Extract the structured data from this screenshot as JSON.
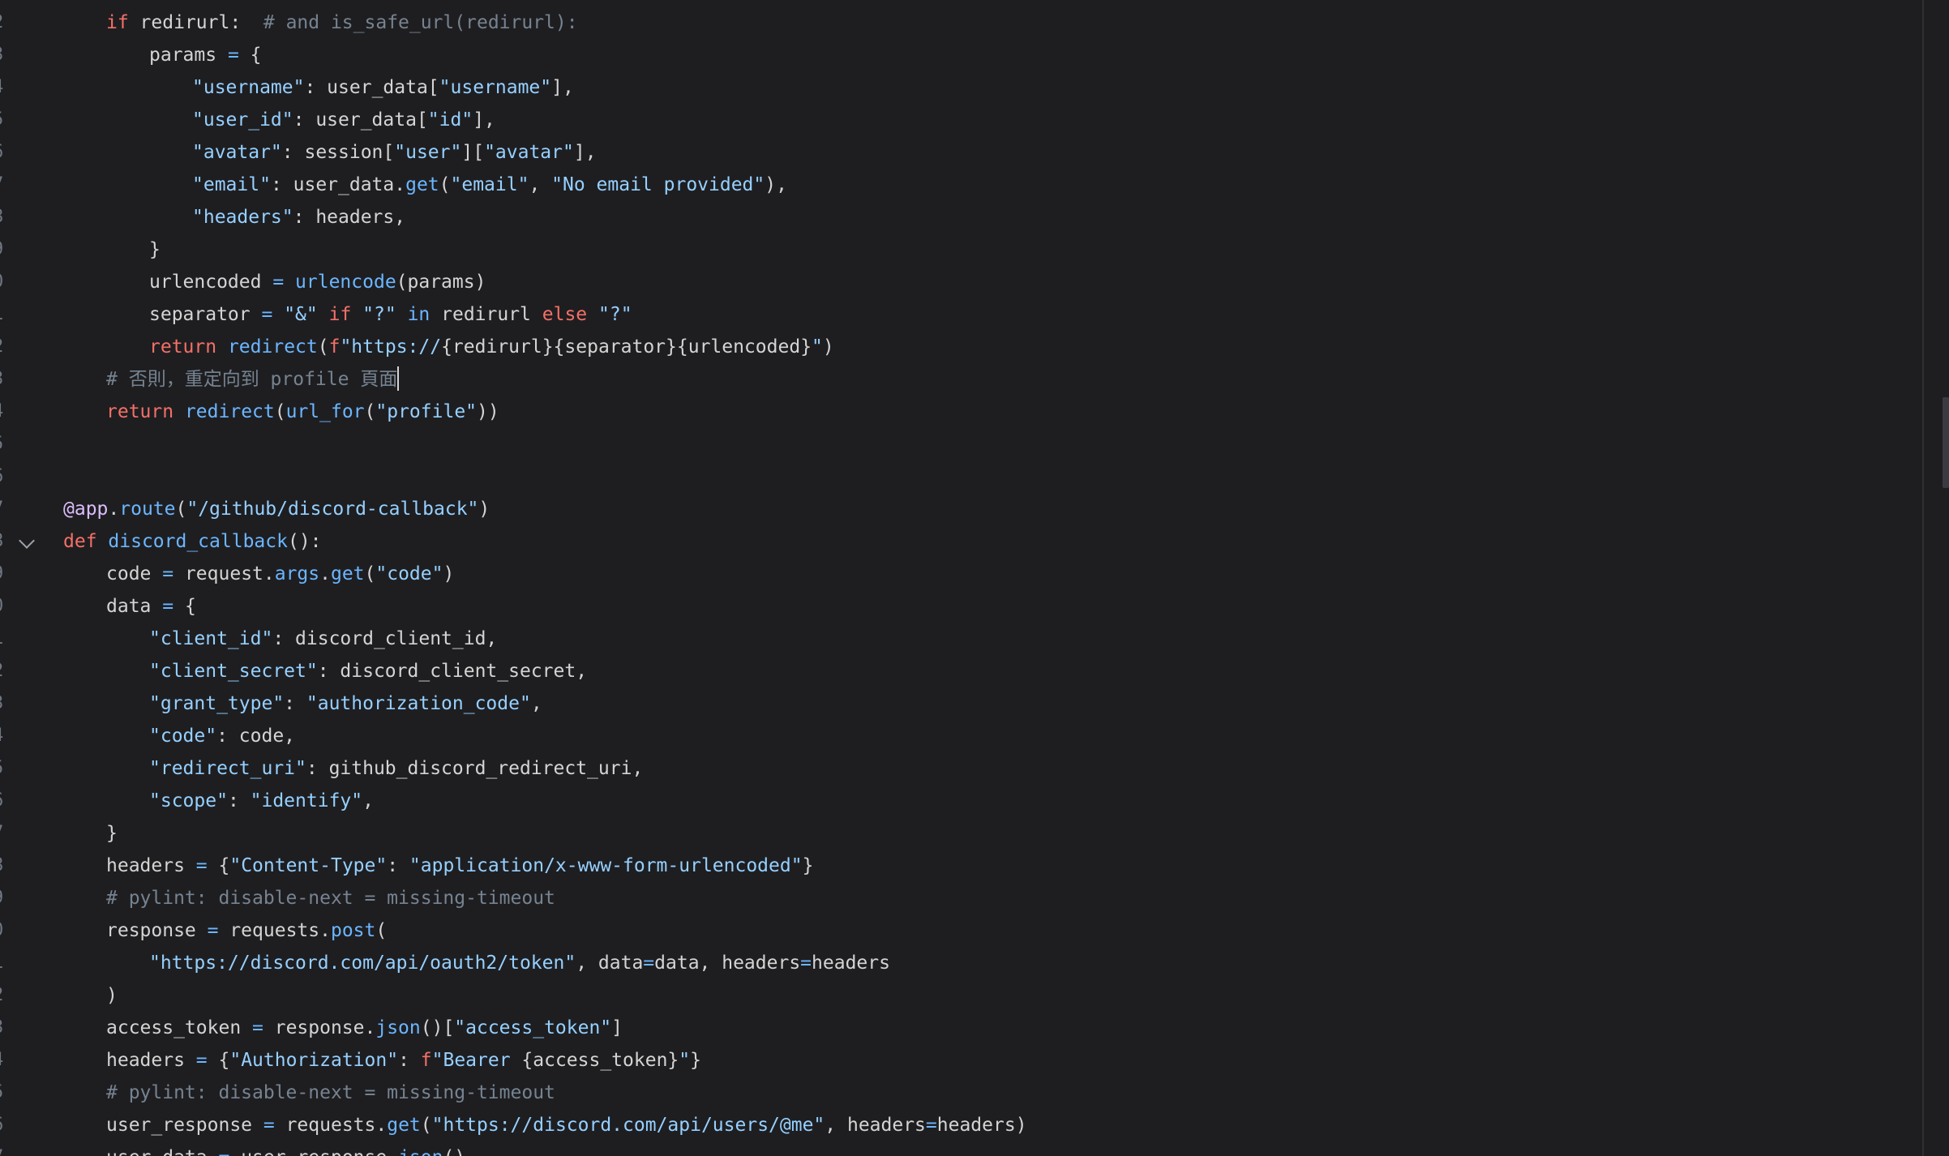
{
  "editor": {
    "colors": {
      "background": "#1e1e21",
      "text": "#d4d4d4",
      "keyword": "#f47067",
      "function": "#6cb6ff",
      "string": "#96d0ff",
      "comment": "#768390",
      "decorator": "#dcbdfb",
      "operator": "#6cb6ff"
    },
    "lines": [
      {
        "ln": "2",
        "indent": 1,
        "tokens": [
          [
            "kw",
            "if"
          ],
          [
            "d",
            " redirurl:  "
          ],
          [
            "c",
            "# and is_safe_url(redirurl):"
          ]
        ]
      },
      {
        "ln": "3",
        "indent": 2,
        "tokens": [
          [
            "d",
            "params "
          ],
          [
            "op",
            "="
          ],
          [
            "d",
            " {"
          ]
        ]
      },
      {
        "ln": "4",
        "indent": 3,
        "tokens": [
          [
            "s",
            "\"username\""
          ],
          [
            "d",
            ": user_data["
          ],
          [
            "s",
            "\"username\""
          ],
          [
            "d",
            "],"
          ]
        ]
      },
      {
        "ln": "5",
        "indent": 3,
        "tokens": [
          [
            "s",
            "\"user_id\""
          ],
          [
            "d",
            ": user_data["
          ],
          [
            "s",
            "\"id\""
          ],
          [
            "d",
            "],"
          ]
        ]
      },
      {
        "ln": "6",
        "indent": 3,
        "tokens": [
          [
            "s",
            "\"avatar\""
          ],
          [
            "d",
            ": session["
          ],
          [
            "s",
            "\"user\""
          ],
          [
            "d",
            "]["
          ],
          [
            "s",
            "\"avatar\""
          ],
          [
            "d",
            "],"
          ]
        ]
      },
      {
        "ln": "7",
        "indent": 3,
        "tokens": [
          [
            "s",
            "\"email\""
          ],
          [
            "d",
            ": user_data."
          ],
          [
            "fn",
            "get"
          ],
          [
            "d",
            "("
          ],
          [
            "s",
            "\"email\""
          ],
          [
            "d",
            ", "
          ],
          [
            "s",
            "\"No email provided\""
          ],
          [
            "d",
            "),"
          ]
        ]
      },
      {
        "ln": "8",
        "indent": 3,
        "tokens": [
          [
            "s",
            "\"headers\""
          ],
          [
            "d",
            ": headers,"
          ]
        ]
      },
      {
        "ln": "9",
        "indent": 2,
        "tokens": [
          [
            "d",
            "}"
          ]
        ]
      },
      {
        "ln": "0",
        "indent": 2,
        "tokens": [
          [
            "d",
            "urlencoded "
          ],
          [
            "op",
            "="
          ],
          [
            "d",
            " "
          ],
          [
            "fn",
            "urlencode"
          ],
          [
            "d",
            "(params)"
          ]
        ]
      },
      {
        "ln": "1",
        "indent": 2,
        "tokens": [
          [
            "d",
            "separator "
          ],
          [
            "op",
            "="
          ],
          [
            "d",
            " "
          ],
          [
            "s",
            "\"&\""
          ],
          [
            "d",
            " "
          ],
          [
            "kw",
            "if"
          ],
          [
            "d",
            " "
          ],
          [
            "s",
            "\"?\""
          ],
          [
            "d",
            " "
          ],
          [
            "fn",
            "in"
          ],
          [
            "d",
            " redirurl "
          ],
          [
            "kw",
            "else"
          ],
          [
            "d",
            " "
          ],
          [
            "s",
            "\"?\""
          ]
        ]
      },
      {
        "ln": "2",
        "indent": 2,
        "tokens": [
          [
            "kw",
            "return"
          ],
          [
            "d",
            " "
          ],
          [
            "fn",
            "redirect"
          ],
          [
            "d",
            "("
          ],
          [
            "kw",
            "f"
          ],
          [
            "s",
            "\"https://"
          ],
          [
            "d",
            "{redirurl}{separator}{urlencoded}"
          ],
          [
            "s",
            "\""
          ],
          [
            "d",
            ")"
          ]
        ]
      },
      {
        "ln": "3",
        "indent": 1,
        "caret": true,
        "tokens": [
          [
            "c",
            "# 否則，重定向到 profile 頁面"
          ]
        ]
      },
      {
        "ln": "4",
        "indent": 1,
        "tokens": [
          [
            "kw",
            "return"
          ],
          [
            "d",
            " "
          ],
          [
            "fn",
            "redirect"
          ],
          [
            "d",
            "("
          ],
          [
            "fn",
            "url_for"
          ],
          [
            "d",
            "("
          ],
          [
            "s",
            "\"profile\""
          ],
          [
            "d",
            "))"
          ]
        ]
      },
      {
        "ln": "5",
        "indent": 0,
        "tokens": []
      },
      {
        "ln": "6",
        "indent": 0,
        "tokens": []
      },
      {
        "ln": "7",
        "indent": 0,
        "tokens": [
          [
            "dec",
            "@app"
          ],
          [
            "d",
            "."
          ],
          [
            "fn",
            "route"
          ],
          [
            "d",
            "("
          ],
          [
            "s",
            "\"/github/discord-callback\""
          ],
          [
            "d",
            ")"
          ]
        ]
      },
      {
        "ln": "8",
        "indent": 0,
        "fold": true,
        "tokens": [
          [
            "kw",
            "def"
          ],
          [
            "d",
            " "
          ],
          [
            "fn",
            "discord_callback"
          ],
          [
            "d",
            "():"
          ]
        ]
      },
      {
        "ln": "9",
        "indent": 1,
        "tokens": [
          [
            "d",
            "code "
          ],
          [
            "op",
            "="
          ],
          [
            "d",
            " request."
          ],
          [
            "fn",
            "args"
          ],
          [
            "d",
            "."
          ],
          [
            "fn",
            "get"
          ],
          [
            "d",
            "("
          ],
          [
            "s",
            "\"code\""
          ],
          [
            "d",
            ")"
          ]
        ]
      },
      {
        "ln": "0",
        "indent": 1,
        "tokens": [
          [
            "d",
            "data "
          ],
          [
            "op",
            "="
          ],
          [
            "d",
            " {"
          ]
        ]
      },
      {
        "ln": "1",
        "indent": 2,
        "tokens": [
          [
            "s",
            "\"client_id\""
          ],
          [
            "d",
            ": discord_client_id,"
          ]
        ]
      },
      {
        "ln": "2",
        "indent": 2,
        "tokens": [
          [
            "s",
            "\"client_secret\""
          ],
          [
            "d",
            ": discord_client_secret,"
          ]
        ]
      },
      {
        "ln": "3",
        "indent": 2,
        "tokens": [
          [
            "s",
            "\"grant_type\""
          ],
          [
            "d",
            ": "
          ],
          [
            "s",
            "\"authorization_code\""
          ],
          [
            "d",
            ","
          ]
        ]
      },
      {
        "ln": "4",
        "indent": 2,
        "tokens": [
          [
            "s",
            "\"code\""
          ],
          [
            "d",
            ": code,"
          ]
        ]
      },
      {
        "ln": "5",
        "indent": 2,
        "tokens": [
          [
            "s",
            "\"redirect_uri\""
          ],
          [
            "d",
            ": github_discord_redirect_uri,"
          ]
        ]
      },
      {
        "ln": "6",
        "indent": 2,
        "tokens": [
          [
            "s",
            "\"scope\""
          ],
          [
            "d",
            ": "
          ],
          [
            "s",
            "\"identify\""
          ],
          [
            "d",
            ","
          ]
        ]
      },
      {
        "ln": "7",
        "indent": 1,
        "tokens": [
          [
            "d",
            "}"
          ]
        ]
      },
      {
        "ln": "8",
        "indent": 1,
        "tokens": [
          [
            "d",
            "headers "
          ],
          [
            "op",
            "="
          ],
          [
            "d",
            " {"
          ],
          [
            "s",
            "\"Content-Type\""
          ],
          [
            "d",
            ": "
          ],
          [
            "s",
            "\"application/x-www-form-urlencoded\""
          ],
          [
            "d",
            "}"
          ]
        ]
      },
      {
        "ln": "9",
        "indent": 1,
        "tokens": [
          [
            "c",
            "# pylint: disable-next = missing-timeout"
          ]
        ]
      },
      {
        "ln": "0",
        "indent": 1,
        "tokens": [
          [
            "d",
            "response "
          ],
          [
            "op",
            "="
          ],
          [
            "d",
            " requests."
          ],
          [
            "fn",
            "post"
          ],
          [
            "d",
            "("
          ]
        ]
      },
      {
        "ln": "1",
        "indent": 2,
        "tokens": [
          [
            "s",
            "\"https://discord.com/api/oauth2/token\""
          ],
          [
            "d",
            ", data"
          ],
          [
            "op",
            "="
          ],
          [
            "d",
            "data, headers"
          ],
          [
            "op",
            "="
          ],
          [
            "d",
            "headers"
          ]
        ]
      },
      {
        "ln": "2",
        "indent": 1,
        "tokens": [
          [
            "d",
            ")"
          ]
        ]
      },
      {
        "ln": "3",
        "indent": 1,
        "tokens": [
          [
            "d",
            "access_token "
          ],
          [
            "op",
            "="
          ],
          [
            "d",
            " response."
          ],
          [
            "fn",
            "json"
          ],
          [
            "d",
            "()["
          ],
          [
            "s",
            "\"access_token\""
          ],
          [
            "d",
            "]"
          ]
        ]
      },
      {
        "ln": "4",
        "indent": 1,
        "tokens": [
          [
            "d",
            "headers "
          ],
          [
            "op",
            "="
          ],
          [
            "d",
            " {"
          ],
          [
            "s",
            "\"Authorization\""
          ],
          [
            "d",
            ": "
          ],
          [
            "kw",
            "f"
          ],
          [
            "s",
            "\"Bearer "
          ],
          [
            "d",
            "{access_token}"
          ],
          [
            "s",
            "\""
          ],
          [
            "d",
            "}"
          ]
        ]
      },
      {
        "ln": "5",
        "indent": 1,
        "tokens": [
          [
            "c",
            "# pylint: disable-next = missing-timeout"
          ]
        ]
      },
      {
        "ln": "6",
        "indent": 1,
        "tokens": [
          [
            "d",
            "user_response "
          ],
          [
            "op",
            "="
          ],
          [
            "d",
            " requests."
          ],
          [
            "fn",
            "get"
          ],
          [
            "d",
            "("
          ],
          [
            "s",
            "\"https://discord.com/api/users/@me\""
          ],
          [
            "d",
            ", headers"
          ],
          [
            "op",
            "="
          ],
          [
            "d",
            "headers)"
          ]
        ]
      },
      {
        "ln": "7",
        "indent": 1,
        "tokens": [
          [
            "d",
            "user_data "
          ],
          [
            "op",
            "="
          ],
          [
            "d",
            " user_response."
          ],
          [
            "fn",
            "json"
          ],
          [
            "d",
            "()"
          ]
        ]
      }
    ]
  }
}
